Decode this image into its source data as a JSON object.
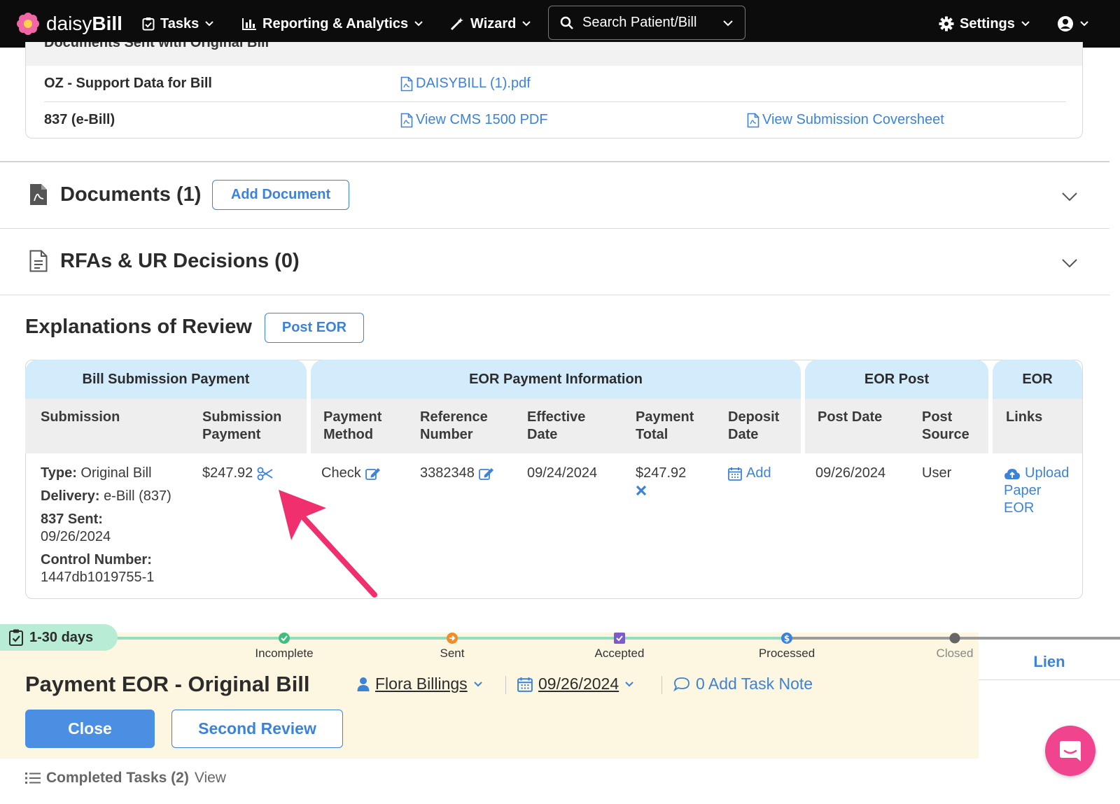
{
  "nav": {
    "brand_light": "daisy",
    "brand_bold": "Bill",
    "tasks": "Tasks",
    "reporting": "Reporting & Analytics",
    "wizard": "Wizard",
    "search_placeholder": "Search Patient/Bill",
    "settings": "Settings"
  },
  "documents_sent": {
    "heading": "Documents Sent with Original Bill",
    "rows": [
      {
        "label": "OZ - Support Data for Bill",
        "link1": "DAISYBILL (1).pdf"
      },
      {
        "label": "837 (e-Bill)",
        "link1": "View CMS 1500 PDF",
        "link2": "View Submission Coversheet"
      }
    ]
  },
  "sections": {
    "documents_title": "Documents (1)",
    "add_document": "Add Document",
    "rfas_title": "RFAs & UR Decisions (0)"
  },
  "eor": {
    "title": "Explanations of Review",
    "post_button": "Post EOR",
    "groups": [
      "Bill Submission Payment",
      "EOR Payment Information",
      "EOR Post",
      "EOR"
    ],
    "columns": {
      "submission": "Submission",
      "submission_payment": [
        "Submission",
        "Payment"
      ],
      "payment_method": [
        "Payment",
        "Method"
      ],
      "reference_number": [
        "Reference",
        "Number"
      ],
      "effective_date": [
        "Effective",
        "Date"
      ],
      "payment_total": [
        "Payment",
        "Total"
      ],
      "deposit_date": [
        "Deposit",
        "Date"
      ],
      "post_date": "Post Date",
      "post_source": [
        "Post",
        "Source"
      ],
      "links": "Links"
    },
    "row": {
      "type_label": "Type:",
      "type_value": "Original Bill",
      "delivery_label": "Delivery:",
      "delivery_value": "e-Bill (837)",
      "sent_label": "837 Sent:",
      "sent_value": "09/26/2024",
      "control_label": "Control Number:",
      "control_value": "1447db1019755-1",
      "submission_payment": "$247.92",
      "payment_method": "Check",
      "reference_number": "3382348",
      "effective_date": "09/24/2024",
      "payment_total": "$247.92",
      "deposit_add": "Add",
      "post_date": "09/26/2024",
      "post_source": "User",
      "upload_link": [
        "Upload",
        "Paper",
        "EOR"
      ]
    }
  },
  "task": {
    "days": "1-30 days",
    "stages": [
      "Incomplete",
      "Sent",
      "Accepted",
      "Processed",
      "Closed"
    ],
    "title": "Payment EOR - Original Bill",
    "assignee": "Flora Billings",
    "due_date": "09/26/2024",
    "note": "0 Add Task Note",
    "close_button": "Close",
    "second_review_button": "Second Review",
    "lien_tab": "Lien",
    "completed_label": "Completed Tasks (2)",
    "completed_view": "View"
  },
  "colors": {
    "accent": "#3c83d8",
    "group_header": "#d3ecfb",
    "task_bg": "#fdf6e0",
    "annotation_arrow": "#f0306e"
  }
}
